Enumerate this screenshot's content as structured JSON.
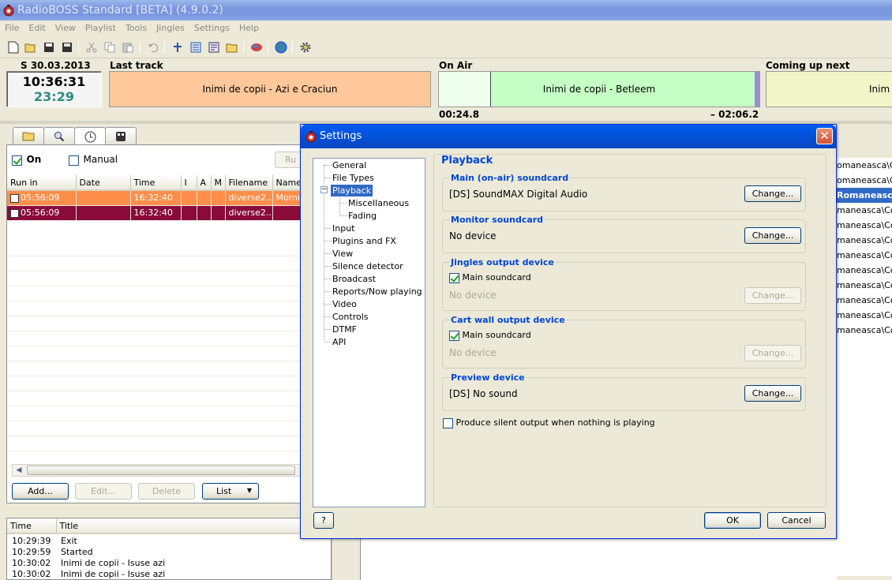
{
  "app": {
    "title": "RadioBOSS Standard [BETA] (4.9.0.2)",
    "menu": [
      "File",
      "Edit",
      "View",
      "Playlist",
      "Tools",
      "Jingles",
      "Settings",
      "Help"
    ]
  },
  "status": {
    "date": "S 30.03.2013",
    "time": "10:36:31",
    "remaining": "23:29",
    "last_track_label": "Last track",
    "last_track": "Inimi de copii - Azi e Craciun",
    "on_air_label": "On Air",
    "on_air": "Inimi de copii - Betleem",
    "on_air_elapsed": "00:24.8",
    "on_air_remaining": "– 02:06.2",
    "next_label": "Coming up next",
    "next_track": "Inim",
    "colors": {
      "last": "#ffc89a",
      "onair": "#c5ffc5",
      "next": "#f2f5c7"
    }
  },
  "scheduler": {
    "on_label": "On",
    "manual_label": "Manual",
    "run_button": "Ru",
    "columns": [
      "Run in",
      "Date",
      "Time",
      "I",
      "A",
      "M",
      "Filename",
      "Name"
    ],
    "rows": [
      {
        "run_in": "05:56:09",
        "date": "",
        "time": "16:32:40",
        "i": "",
        "a": "",
        "m": "",
        "filename": "diverse2...",
        "name": "Mornin"
      },
      {
        "run_in": "05:56:09",
        "date": "",
        "time": "16:32:40",
        "i": "",
        "a": "",
        "m": "",
        "filename": "diverse2...",
        "name": ""
      }
    ],
    "buttons": {
      "add": "Add...",
      "edit": "Edit...",
      "delete": "Delete",
      "list": "List"
    }
  },
  "log": {
    "columns": [
      "Time",
      "Title"
    ],
    "rows": [
      {
        "time": "10:29:39",
        "title": "Exit"
      },
      {
        "time": "10:29:59",
        "title": "Started"
      },
      {
        "time": "10:30:02",
        "title": "Inimi de copii - Isuse azi"
      },
      {
        "time": "10:30:02",
        "title": "Inimi de copii - Isuse azi"
      }
    ]
  },
  "right_list": {
    "items": [
      "omaneasca\\Coru",
      "omaneasca\\Coru",
      "Romaneasca",
      "maneasca\\Coru",
      "maneasca\\Coru",
      "maneasca\\Coru",
      "maneasca\\Coru",
      "maneasca\\Coru",
      "maneasca\\Coru",
      "maneasca\\Coru",
      "maneasca\\Coru",
      "maneasca\\Coru",
      "maneasca\\Coru"
    ],
    "selected_index": 2
  },
  "settings": {
    "title": "Settings",
    "tree": {
      "general": "General",
      "file_types": "File Types",
      "playback": "Playback",
      "misc": "Miscellaneous",
      "fading": "Fading",
      "input": "Input",
      "plugins": "Plugins and FX",
      "view": "View",
      "silence": "Silence detector",
      "broadcast": "Broadcast",
      "reports": "Reports/Now playing",
      "video": "Video",
      "controls": "Controls",
      "dtmf": "DTMF",
      "api": "API",
      "selected": "Playback"
    },
    "page_title": "Playback",
    "main": {
      "title": "Main (on-air) soundcard",
      "value": "[DS] SoundMAX Digital Audio",
      "button": "Change..."
    },
    "monitor": {
      "title": "Monitor soundcard",
      "value": "No device",
      "button": "Change..."
    },
    "jingles": {
      "title": "Jingles output device",
      "checkbox": "Main soundcard",
      "value": "No device",
      "button": "Change..."
    },
    "cartwall": {
      "title": "Cart wall output device",
      "checkbox": "Main soundcard",
      "value": "No device",
      "button": "Change..."
    },
    "preview": {
      "title": "Preview device",
      "value": "[DS] No sound",
      "button": "Change..."
    },
    "silent_output": "Produce silent output when nothing is playing",
    "help_button": "?",
    "ok_button": "OK",
    "cancel_button": "Cancel"
  }
}
